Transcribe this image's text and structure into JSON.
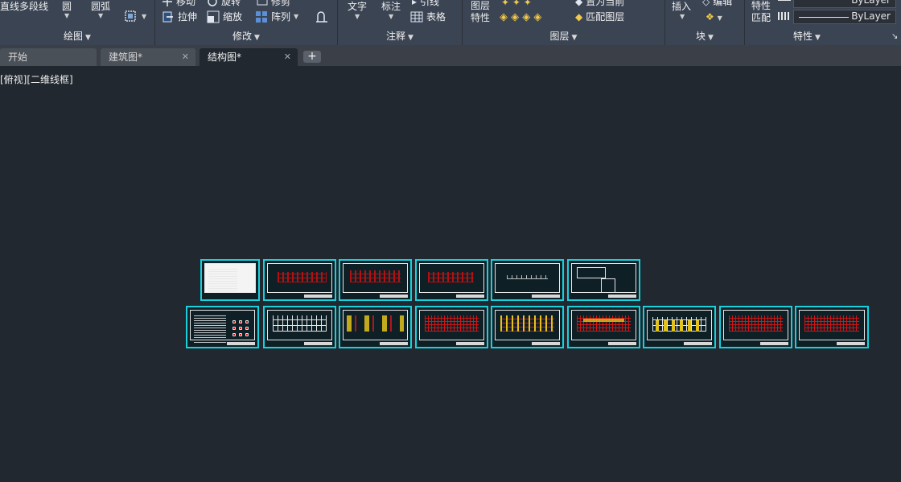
{
  "ribbon": {
    "draw": {
      "items": [
        "直线",
        "多段线",
        "圆",
        "圆弧"
      ],
      "title": "绘图"
    },
    "modify": {
      "items": [
        "移动",
        "旋转",
        "修剪",
        "拉伸",
        "缩放",
        "阵列"
      ],
      "title": "修改"
    },
    "annotation": {
      "text": "文字",
      "dimension": "标注",
      "leader": "引线",
      "table": "表格",
      "title": "注释"
    },
    "layers": {
      "layer_properties": "图层\n特性",
      "make_current": "置为当前",
      "match_layer": "匹配图层",
      "title": "图层"
    },
    "block": {
      "insert": "插入",
      "edit": "编辑",
      "title": "块"
    },
    "properties": {
      "match": "特性\n匹配",
      "color": "ByLayer",
      "linetype": "ByLayer",
      "title": "特性"
    }
  },
  "tabs": [
    {
      "label": "开始",
      "active": false,
      "closable": false
    },
    {
      "label": "建筑图*",
      "active": false,
      "closable": true
    },
    {
      "label": "结构图*",
      "active": true,
      "closable": true
    }
  ],
  "add_tab_label": "+",
  "viewport": {
    "label": "[俯视][二维线框]"
  },
  "colors": {
    "ribbon_bg": "#3b4453",
    "canvas_bg": "#212830",
    "sheet_border": "#17d1dd"
  }
}
